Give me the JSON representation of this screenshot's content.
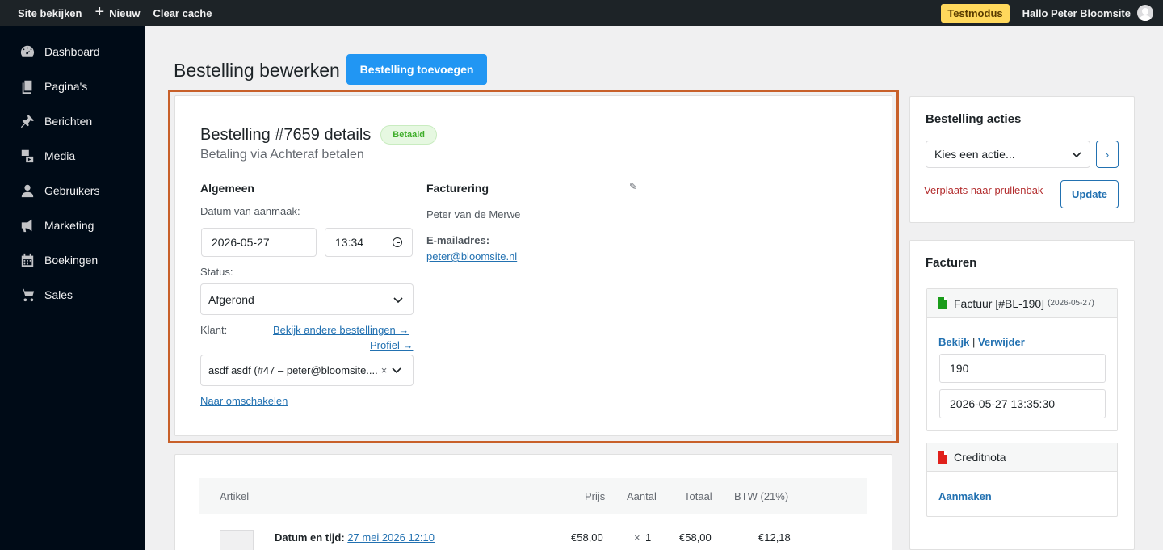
{
  "adminbar": {
    "site_link": "Site bekijken",
    "new_label": "Nieuw",
    "clear_cache": "Clear cache",
    "test_mode": "Testmodus",
    "greeting": "Hallo Peter Bloomsite"
  },
  "sidebar": {
    "items": [
      {
        "label": "Dashboard",
        "icon": "dashboard-icon"
      },
      {
        "label": "Pagina's",
        "icon": "pages-icon"
      },
      {
        "label": "Berichten",
        "icon": "pin-icon"
      },
      {
        "label": "Media",
        "icon": "media-icon"
      },
      {
        "label": "Gebruikers",
        "icon": "user-icon"
      },
      {
        "label": "Marketing",
        "icon": "megaphone-icon"
      },
      {
        "label": "Boekingen",
        "icon": "calendar-icon"
      },
      {
        "label": "Sales",
        "icon": "cart-icon"
      }
    ]
  },
  "page": {
    "title": "Bestelling bewerken",
    "add_button": "Bestelling toevoegen"
  },
  "order": {
    "heading": "Bestelling #7659 details",
    "status_badge": "Betaald",
    "payment_via": "Betaling via Achteraf betalen",
    "general": {
      "heading": "Algemeen",
      "date_label": "Datum van aanmaak:",
      "date_value": "2026-05-27",
      "time_value": "13:34",
      "status_label": "Status:",
      "status_value": "Afgerond",
      "customer_label": "Klant:",
      "other_orders_link": "Bekijk andere bestellingen →",
      "profile_link": "Profiel →",
      "customer_value": "asdf asdf (#47 – peter@bloomsite....",
      "switch_link": "Naar omschakelen"
    },
    "billing": {
      "heading": "Facturering",
      "name": "Peter van de Merwe",
      "email_label": "E-mailadres:",
      "email": "peter@bloomsite.nl"
    }
  },
  "items": {
    "headers": {
      "article": "Artikel",
      "price": "Prijs",
      "qty": "Aantal",
      "total": "Totaal",
      "vat": "BTW (21%)"
    },
    "rows": [
      {
        "label": "Datum en tijd:",
        "link": "27 mei 2026 12:10",
        "price": "€58,00",
        "qty_sign": "×",
        "qty": "1",
        "total": "€58,00",
        "vat": "€12,18"
      }
    ]
  },
  "actions": {
    "heading": "Bestelling acties",
    "select_value": "Kies een actie...",
    "go_label": "›",
    "trash_link": "Verplaats naar prullenbak",
    "update": "Update"
  },
  "invoices": {
    "heading": "Facturen",
    "invoice": {
      "title": "Factuur [#BL-190]",
      "date": "(2026-05-27)",
      "view": "Bekijk",
      "separator": "|",
      "delete": "Verwijder",
      "number": "190",
      "datetime": "2026-05-27 13:35:30",
      "icon_color": "#1a9c1a"
    },
    "credit": {
      "title": "Creditnota",
      "create": "Aanmaken",
      "icon_color": "#e0201b"
    }
  }
}
